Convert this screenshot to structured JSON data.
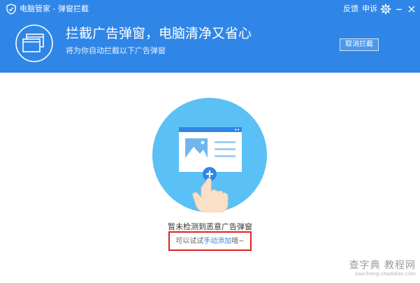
{
  "titlebar": {
    "app_title": "电脑管家 - 弹窗拦截",
    "feedback": "反馈",
    "complaint": "申诉",
    "icons": [
      "settings-gear-icon",
      "minimize-icon",
      "close-icon"
    ]
  },
  "banner": {
    "title": "拦截广告弹窗，电脑清净又省心",
    "subtitle": "将为你自动拦截以下广告弹窗",
    "cancel_button": "取消拦截",
    "icon": "popup-windows-icon"
  },
  "empty_state": {
    "illustration": "hand-add-window-illustration",
    "title": "暂未检测到恶意广告弹窗",
    "hint_prefix": "可以试试",
    "hint_link": "手动添加",
    "hint_suffix": "哦~"
  },
  "watermark": {
    "main": "查字典 教程网",
    "sub": "jiaocheng.chazidian.com"
  },
  "colors": {
    "header_bg": "#2f86e6",
    "circle_bg": "#5bc0f5",
    "highlight_box": "#e02020",
    "link": "#2f86e6"
  }
}
